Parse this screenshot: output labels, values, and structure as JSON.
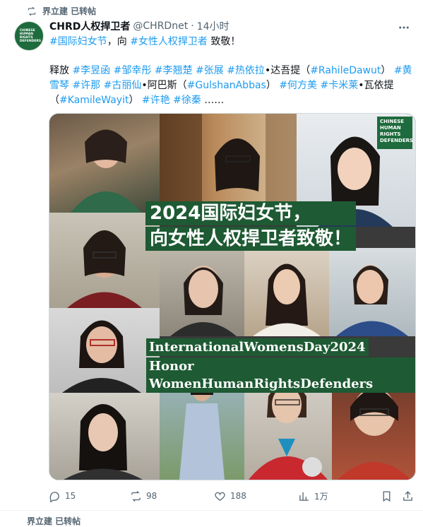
{
  "repost": {
    "text": "界立建 已转帖",
    "icon": "repost-icon"
  },
  "author": {
    "display_name": "CHRD人权捍卫者",
    "handle": "@CHRDnet",
    "dot": "·",
    "time": "14小时",
    "avatar_text": [
      "CHINESE",
      "HUMAN",
      "RIGHTS",
      "DEFENDERS"
    ]
  },
  "tweet": {
    "line1": {
      "tag1": "#国际妇女节",
      "mid": "，向 ",
      "tag2": "#女性人权捍卫者",
      "end": " 致敬！"
    },
    "body_segments": [
      {
        "t": "释放 ",
        "tag": false
      },
      {
        "t": "#李昱函",
        "tag": true
      },
      {
        "t": " ",
        "tag": false
      },
      {
        "t": "#邹幸彤",
        "tag": true
      },
      {
        "t": " ",
        "tag": false
      },
      {
        "t": "#李翘楚",
        "tag": true
      },
      {
        "t": " ",
        "tag": false
      },
      {
        "t": "#张展",
        "tag": true
      },
      {
        "t": " ",
        "tag": false
      },
      {
        "t": "#热依拉",
        "tag": true
      },
      {
        "t": "•达吾提（",
        "tag": false
      },
      {
        "t": "#RahileDawut",
        "tag": true
      },
      {
        "t": "） ",
        "tag": false
      },
      {
        "t": "#黄雪琴",
        "tag": true
      },
      {
        "t": " ",
        "tag": false
      },
      {
        "t": "#许那",
        "tag": true
      },
      {
        "t": " ",
        "tag": false
      },
      {
        "t": "#古丽仙",
        "tag": true
      },
      {
        "t": "•阿巴斯（",
        "tag": false
      },
      {
        "t": "#GulshanAbbas",
        "tag": true
      },
      {
        "t": "） ",
        "tag": false
      },
      {
        "t": "#何方美",
        "tag": true
      },
      {
        "t": " ",
        "tag": false
      },
      {
        "t": "#卡米莱",
        "tag": true
      },
      {
        "t": "•瓦依提（",
        "tag": false
      },
      {
        "t": "#KamileWayit",
        "tag": true
      },
      {
        "t": "） ",
        "tag": false
      },
      {
        "t": "#许艳",
        "tag": true
      },
      {
        "t": " ",
        "tag": false
      },
      {
        "t": "#徐秦",
        "tag": true
      },
      {
        "t": " ……",
        "tag": false
      }
    ]
  },
  "media": {
    "title_line1": "2024国际妇女节，",
    "title_line2": "向女性人权捍卫者致敬！",
    "en_line1": "InternationalWomensDay2024",
    "en_line2": "Honor WomenHumanRightsDefenders",
    "logo_lines": [
      "CHINESE",
      "HUMAN",
      "RIGHTS",
      "DEFENDERS"
    ],
    "overlay_color": "#1e5a33"
  },
  "stats": {
    "replies": "15",
    "reposts": "98",
    "likes": "188",
    "views": "1万"
  },
  "next_peek": "界立建 已转帖"
}
